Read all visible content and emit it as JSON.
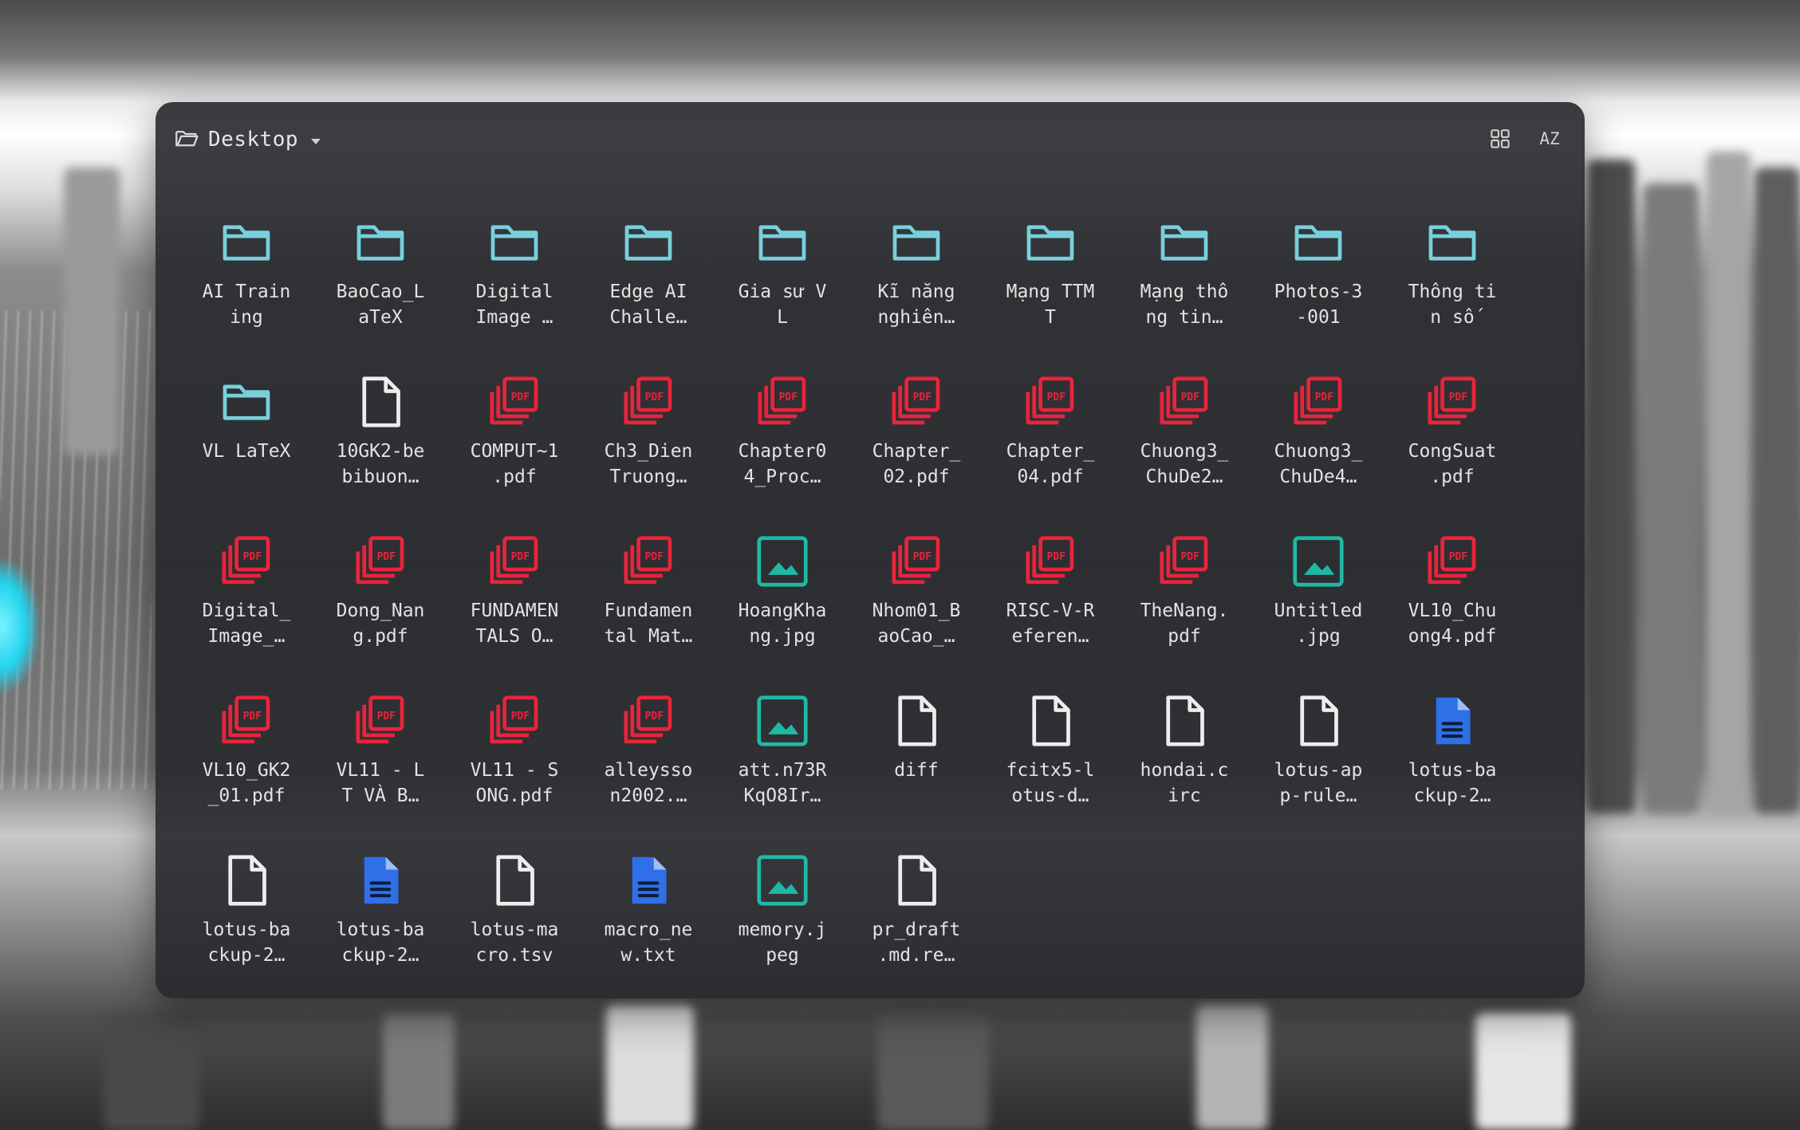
{
  "window": {
    "title": "Desktop",
    "header_icons": [
      "folder-open-icon",
      "grid-view-icon",
      "sort-az-icon"
    ],
    "sort_label": "AZ"
  },
  "colors": {
    "folder": "#78d0dc",
    "pdf": "#e8243c",
    "image": "#1fb8a4",
    "text_doc": "#2f6fe8",
    "generic": "#ededed",
    "label": "#e3e3e3"
  },
  "files": [
    {
      "label": "AI Train\ning",
      "type": "folder"
    },
    {
      "label": "BaoCao_L\naTeX",
      "type": "folder"
    },
    {
      "label": "Digital\nImage …",
      "type": "folder"
    },
    {
      "label": "Edge AI\nChalle…",
      "type": "folder"
    },
    {
      "label": "Gia sư V\nL",
      "type": "folder"
    },
    {
      "label": "Kĩ năng\nnghiên…",
      "type": "folder"
    },
    {
      "label": "Mạng TTM\nT",
      "type": "folder"
    },
    {
      "label": "Mạng thô\nng tin…",
      "type": "folder"
    },
    {
      "label": "Photos-3\n-001",
      "type": "folder"
    },
    {
      "label": "Thông ti\nn số",
      "type": "folder"
    },
    {
      "label": "VL LaTeX",
      "type": "folder"
    },
    {
      "label": "10GK2-be\nbibuon…",
      "type": "generic"
    },
    {
      "label": "COMPUT~1\n.pdf",
      "type": "pdf"
    },
    {
      "label": "Ch3_Dien\nTruong…",
      "type": "pdf"
    },
    {
      "label": "Chapter0\n4_Proc…",
      "type": "pdf"
    },
    {
      "label": "Chapter_\n02.pdf",
      "type": "pdf"
    },
    {
      "label": "Chapter_\n04.pdf",
      "type": "pdf"
    },
    {
      "label": "Chuong3_\nChuDe2…",
      "type": "pdf"
    },
    {
      "label": "Chuong3_\nChuDe4…",
      "type": "pdf"
    },
    {
      "label": "CongSuat\n.pdf",
      "type": "pdf"
    },
    {
      "label": "Digital_\nImage_…",
      "type": "pdf"
    },
    {
      "label": "Dong_Nan\ng.pdf",
      "type": "pdf"
    },
    {
      "label": "FUNDAMEN\nTALS O…",
      "type": "pdf"
    },
    {
      "label": "Fundamen\ntal Mat…",
      "type": "pdf"
    },
    {
      "label": "HoangKha\nng.jpg",
      "type": "image"
    },
    {
      "label": "Nhom01_B\naoCao_…",
      "type": "pdf"
    },
    {
      "label": "RISC-V-R\neferen…",
      "type": "pdf"
    },
    {
      "label": "TheNang.\npdf",
      "type": "pdf"
    },
    {
      "label": "Untitled\n.jpg",
      "type": "image"
    },
    {
      "label": "VL10_Chu\nong4.pdf",
      "type": "pdf"
    },
    {
      "label": "VL10_GK2\n_01.pdf",
      "type": "pdf"
    },
    {
      "label": "VL11 - L\nT VÀ B…",
      "type": "pdf"
    },
    {
      "label": "VL11 - S\nONG.pdf",
      "type": "pdf"
    },
    {
      "label": "alleysso\nn2002.…",
      "type": "pdf"
    },
    {
      "label": "att.n73R\nKqO8Ir…",
      "type": "image"
    },
    {
      "label": "diff",
      "type": "generic"
    },
    {
      "label": "fcitx5-l\notus-d…",
      "type": "generic"
    },
    {
      "label": "hondai.c\nirc",
      "type": "generic"
    },
    {
      "label": "lotus-ap\np-rule…",
      "type": "generic"
    },
    {
      "label": "lotus-ba\nckup-2…",
      "type": "text_doc"
    },
    {
      "label": "lotus-ba\nckup-2…",
      "type": "generic"
    },
    {
      "label": "lotus-ba\nckup-2…",
      "type": "text_doc"
    },
    {
      "label": "lotus-ma\ncro.tsv",
      "type": "generic"
    },
    {
      "label": "macro_ne\nw.txt",
      "type": "text_doc"
    },
    {
      "label": "memory.j\npeg",
      "type": "image"
    },
    {
      "label": "pr_draft\n.md.re…",
      "type": "generic"
    }
  ]
}
